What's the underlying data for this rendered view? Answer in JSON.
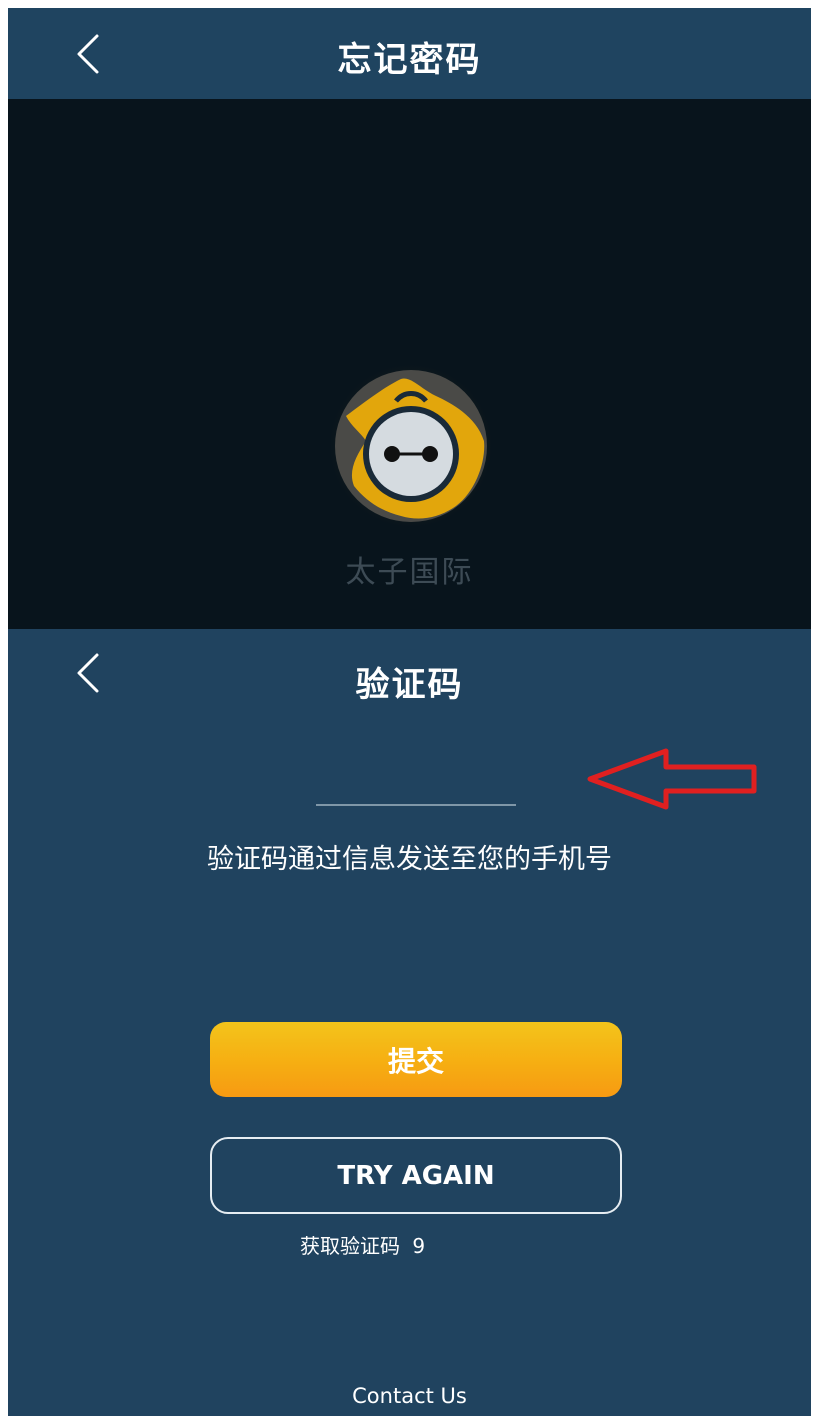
{
  "top_header": {
    "title": "忘记密码",
    "back_icon": "chevron-left-icon"
  },
  "splash": {
    "app_name": "太子国际",
    "logo_icon": "robot-mascot-logo",
    "colors": {
      "ring": "#e2a60c",
      "face": "#d5dbe0",
      "background": "#08141c"
    }
  },
  "verification": {
    "title": "验证码",
    "back_icon": "chevron-left-icon",
    "message": "验证码通过信息发送至您的手机号",
    "submit_label": "提交",
    "try_again_label": "TRY AGAIN",
    "resend_label": "获取验证码",
    "resend_countdown": "9",
    "contact_label": "Contact Us"
  },
  "annotation": {
    "arrow_icon": "red-arrow-left-icon",
    "color": "#e02020"
  },
  "colors": {
    "header_bg": "#1f4460",
    "panel_bg": "#20435f",
    "accent_yellow": "#f6b514",
    "text": "#ffffff"
  }
}
